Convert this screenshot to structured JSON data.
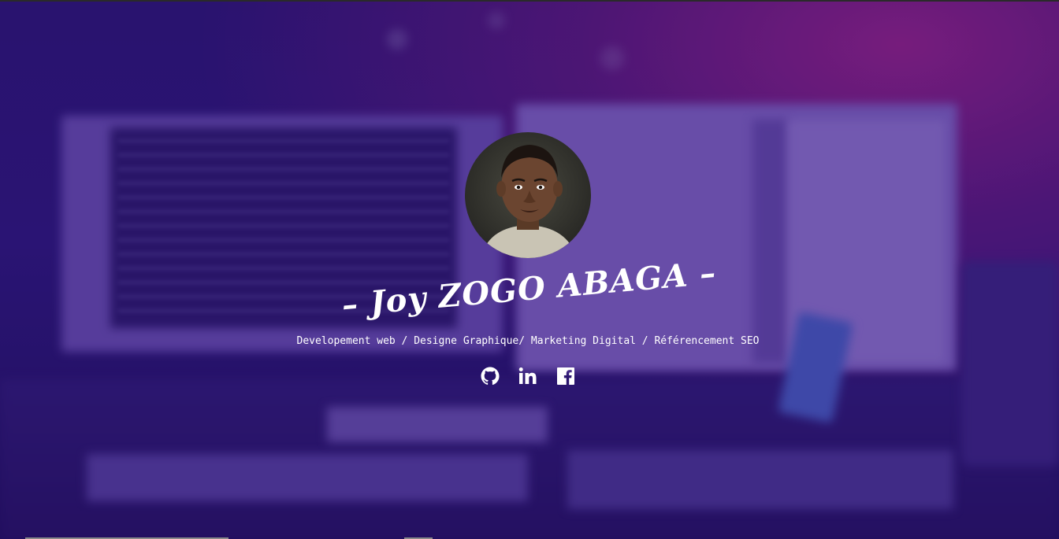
{
  "profile": {
    "name": "– Joy ZOGO ABAGA –",
    "tagline": "Developement web / Designe Graphique/ Marketing Digital / Référencement SEO"
  },
  "socials": [
    {
      "icon": "github-icon"
    },
    {
      "icon": "linkedin-icon"
    },
    {
      "icon": "facebook-icon"
    }
  ],
  "colors": {
    "overlay": "#2b1678",
    "accent": "#c8288c",
    "text": "#ffffff"
  }
}
